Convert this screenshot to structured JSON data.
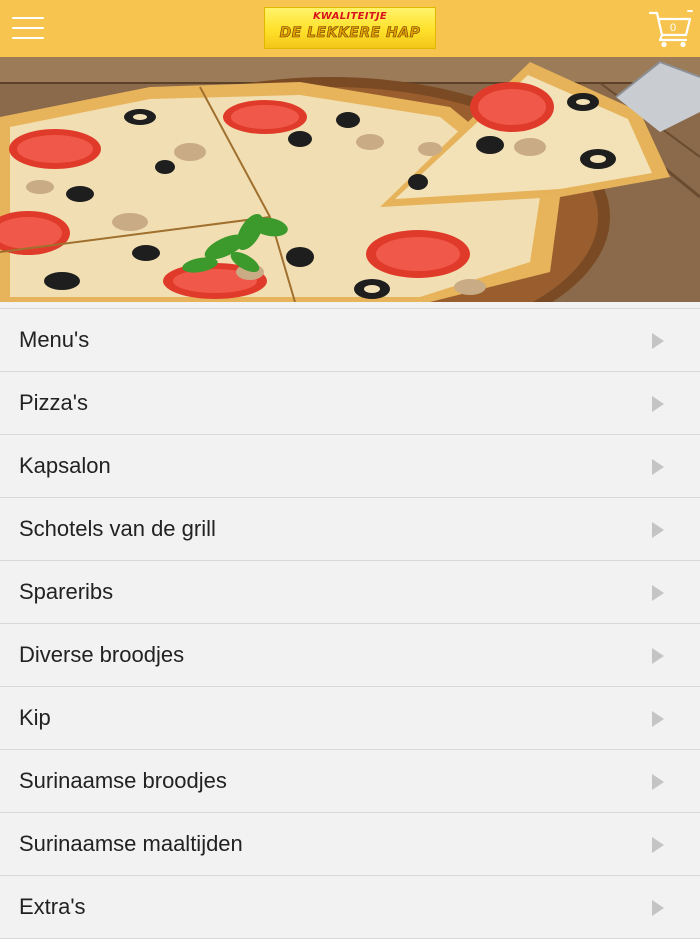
{
  "header": {
    "menu_icon": "hamburger-icon",
    "logo_top": "KWALITEITJE",
    "logo_main": "DE LEKKERE HAP",
    "cart_icon": "shopping-cart-icon",
    "cart_count": "0",
    "background_color": "#f7c54f"
  },
  "hero": {
    "description_icon": "pizza-hero-image"
  },
  "menu": {
    "arrow_icon": "chevron-right-icon",
    "items": [
      {
        "label": "Menu's"
      },
      {
        "label": "Pizza's"
      },
      {
        "label": "Kapsalon"
      },
      {
        "label": "Schotels van de grill"
      },
      {
        "label": "Spareribs"
      },
      {
        "label": "Diverse broodjes"
      },
      {
        "label": "Kip"
      },
      {
        "label": "Surinaamse broodjes"
      },
      {
        "label": "Surinaamse maaltijden"
      },
      {
        "label": "Extra's"
      }
    ]
  }
}
